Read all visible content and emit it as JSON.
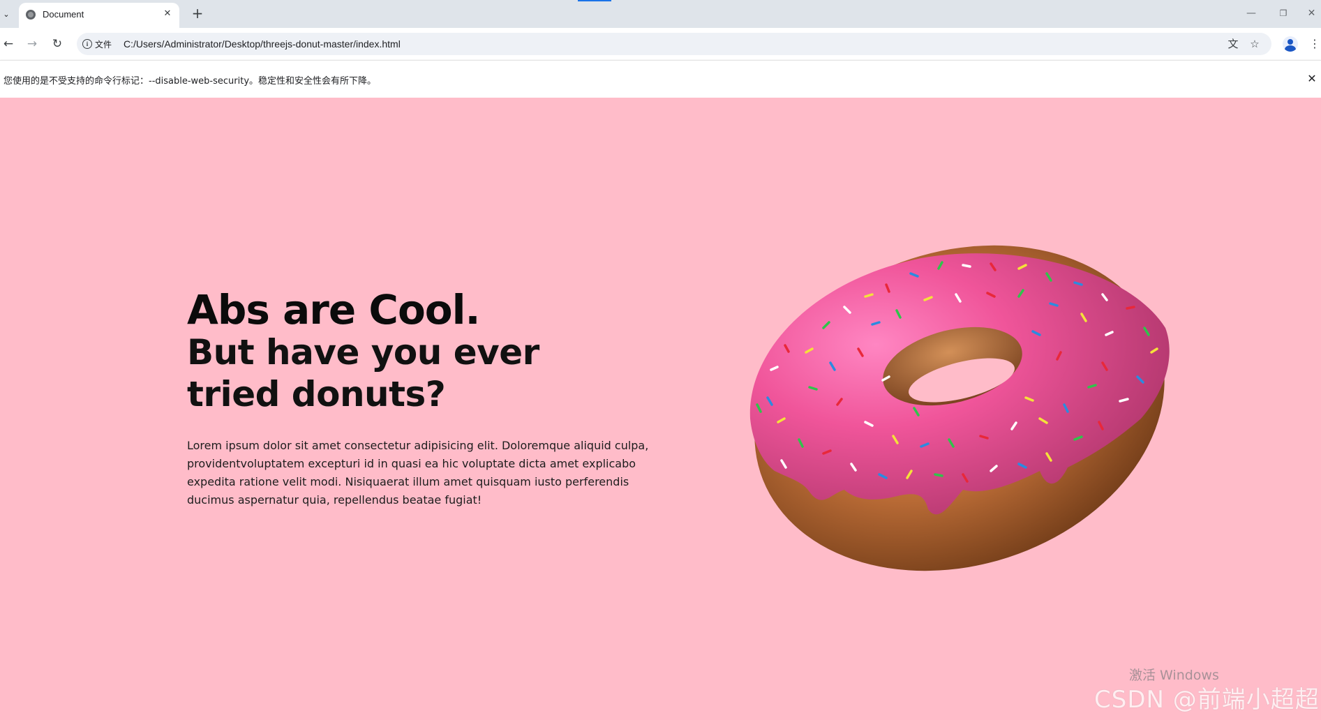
{
  "browser": {
    "tab_title": "Document",
    "address_chip": "文件",
    "url": "C:/Users/Administrator/Desktop/threejs-donut-master/index.html",
    "icons": {
      "tab_list": "chevron-down-icon",
      "favicon": "globe-icon",
      "tab_close": "close-icon",
      "new_tab": "plus-icon",
      "back": "arrow-left-icon",
      "forward": "arrow-right-icon",
      "reload": "reload-icon",
      "info": "info-icon",
      "translate": "translate-icon",
      "bookmark": "star-icon",
      "profile": "profile-icon",
      "menu": "more-vertical-icon",
      "minimize": "minimize-icon",
      "restore": "restore-icon",
      "window_close": "close-icon"
    }
  },
  "infobar": {
    "message": "您使用的是不受支持的命令行标记：--disable-web-security。稳定性和安全性会有所下降。"
  },
  "hero": {
    "title": "Abs are Cool.",
    "subtitle": "But have you ever tried donuts?",
    "body": "Lorem ipsum dolor sit amet consectetur adipisicing elit. Doloremque aliquid culpa, providentvoluptatem excepturi id in quasi ea hic voluptate dicta amet explicabo expedita ratione velit modi. Nisiquaerat illum amet quisquam iusto perferendis ducimus aspernatur quia, repellendus beatae fugiat!"
  },
  "watermarks": {
    "windows": "激活 Windows",
    "csdn": "CSDN @前端小超超"
  },
  "colors": {
    "page_background": "#ffbcc9",
    "icing": "#f0559a",
    "dough": "#b86a35",
    "accent": "#1a73e8"
  }
}
